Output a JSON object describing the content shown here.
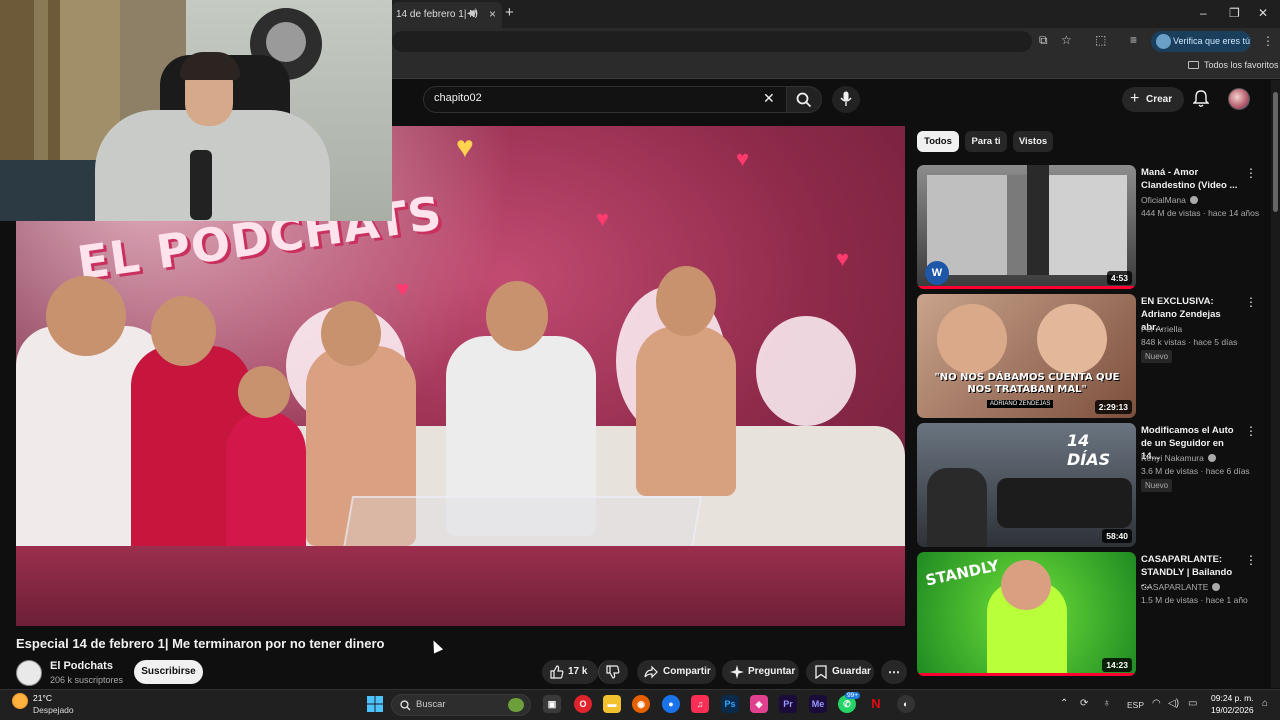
{
  "browser": {
    "tab_title": "14 de febrero 1| M",
    "verify_label": "Verifica que eres tú",
    "bookmarks_folder": "Todos los favoritos"
  },
  "youtube": {
    "search": {
      "value": "chapito02"
    },
    "create_label": "Crear"
  },
  "video": {
    "title": "Especial 14 de febrero 1| Me terminaron por no tener dinero",
    "overlay_text": "EL PODCHATS",
    "channel_name": "El Podchats",
    "subscribers": "206 k suscriptores",
    "subscribe_label": "Suscribirse",
    "likes": "17 k",
    "share_label": "Compartir",
    "ask_label": "Preguntar",
    "save_label": "Guardar"
  },
  "chips": [
    "Todos",
    "Para ti",
    "Vistos"
  ],
  "recommendations": [
    {
      "title": "Maná - Amor Clandestino (Video ...",
      "channel": "OficialMana",
      "verified": true,
      "meta": "444 M de vistas · hace 14 años",
      "badge": "",
      "duration": "4:53",
      "progress": 1.0
    },
    {
      "title": "EN EXCLUSIVA: Adriano Zendejas abr...",
      "channel": "Fer Arriella",
      "verified": false,
      "meta": "848 k vistas · hace 5 días",
      "badge": "Nuevo",
      "duration": "2:29:13",
      "thumb_text": "\"NO NOS DÁBAMOS CUENTA QUE NOS TRATABAN MAL\"",
      "thumb_sub": "ADRIANO ZENDEJAS",
      "progress": 0.0
    },
    {
      "title": "Modificamos el Auto de un Seguidor en 14...",
      "channel": "Kenyi Nakamura",
      "verified": true,
      "meta": "3.6 M de vistas · hace 6 días",
      "badge": "Nuevo",
      "duration": "58:40",
      "thumb_text": "14 DÍAS",
      "progress": 0.0
    },
    {
      "title": "CASAPARLANTE: STANDLY | Bailando -...",
      "channel": "CASAPARLANTE",
      "verified": true,
      "meta": "1.5 M de vistas · hace 1 año",
      "badge": "",
      "duration": "14:23",
      "thumb_text": "STANDLY",
      "progress": 1.0
    }
  ],
  "taskbar": {
    "temperature": "21°C",
    "weather": "Despejado",
    "search_label": "Buscar",
    "lang": "ESP",
    "time": "09:24 p. m.",
    "date": "19/02/2026",
    "notif_badge": "99+"
  },
  "colors": {
    "accent_red": "#ff0033",
    "chip_active": "#f1f1f1",
    "background": "#0f0f0f"
  }
}
